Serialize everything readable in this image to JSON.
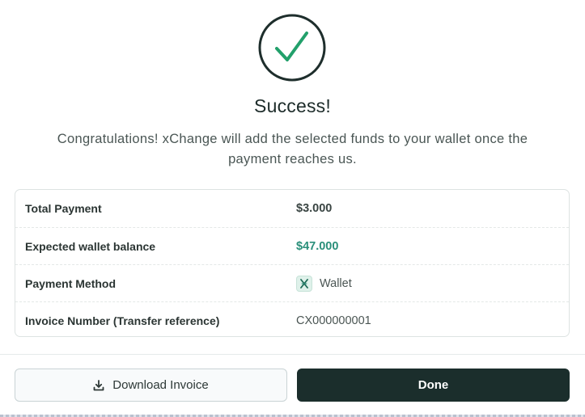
{
  "dialog": {
    "title": "Success!",
    "message": "Congratulations! xChange will add the selected funds to your wallet once the payment reaches us.",
    "icon": "check-circle-icon",
    "accent_color": "#22a06b"
  },
  "details": [
    {
      "label": "Total Payment",
      "value": "$3.000"
    },
    {
      "label": "Expected wallet balance",
      "value": "$47.000"
    },
    {
      "label": "Payment Method",
      "value": "Wallet",
      "icon": "wallet-icon"
    },
    {
      "label": "Invoice Number (Transfer reference)",
      "value": "CX000000001"
    }
  ],
  "actions": {
    "download_label": "Download Invoice",
    "download_icon": "download-icon",
    "done_label": "Done",
    "primary_color": "#1b2e2c"
  }
}
